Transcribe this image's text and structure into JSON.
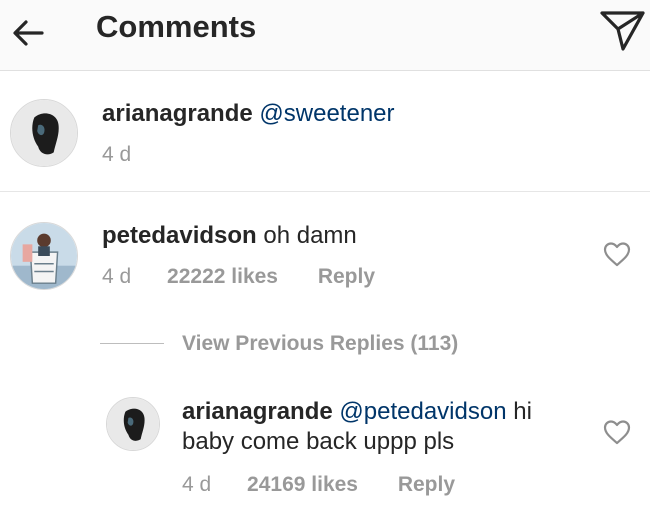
{
  "header": {
    "title": "Comments",
    "back_icon": "arrow-left-icon",
    "send_icon": "paper-plane-icon"
  },
  "caption": {
    "username": "arianagrande",
    "text": "@sweetener",
    "time": "4 d"
  },
  "comments": [
    {
      "username": "petedavidson",
      "text": "oh damn",
      "time": "4 d",
      "likes": "22222 likes",
      "reply_label": "Reply"
    }
  ],
  "view_previous_replies": "View Previous Replies (113)",
  "reply": {
    "username": "arianagrande",
    "mention": "@petedavidson",
    "text_line1_suffix": "hi",
    "text_line2": "baby come back uppp pls",
    "time": "4 d",
    "likes": "24169 likes",
    "reply_label": "Reply"
  },
  "colors": {
    "mention": "#003569",
    "meta": "#999999",
    "text": "#262626"
  }
}
